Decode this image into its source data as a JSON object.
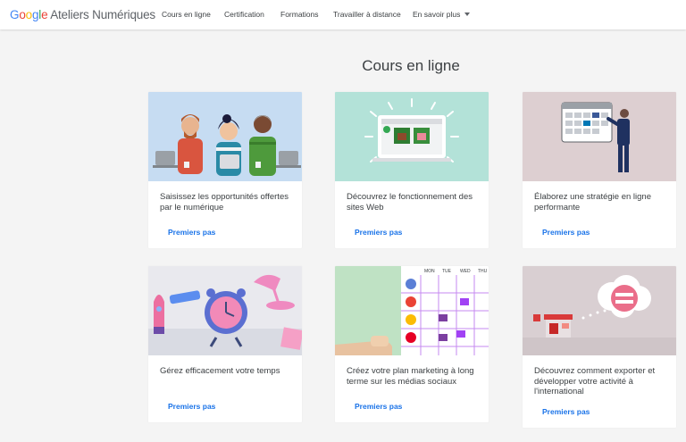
{
  "header": {
    "logo_google": "Google",
    "logo_product": "Ateliers Numériques",
    "nav": [
      {
        "label": "Cours en ligne"
      },
      {
        "label": "Certification"
      },
      {
        "label": "Formations"
      },
      {
        "label": "Travailler à distance"
      },
      {
        "label": "En savoir plus"
      }
    ]
  },
  "main": {
    "title": "Cours en ligne",
    "cards": [
      {
        "title": "Saisissez les opportunités offertes par le numérique",
        "link": "Premiers pas",
        "image_bg": "#c6dcf2"
      },
      {
        "title": "Découvrez le fonctionnement des sites Web",
        "link": "Premiers pas",
        "image_bg": "#b3e2d8"
      },
      {
        "title": "Élaborez une stratégie en ligne performante",
        "link": "Premiers pas",
        "image_bg": "#ddcfd1"
      },
      {
        "title": "Gérez efficacement votre temps",
        "link": "Premiers pas",
        "image_bg": "#e9e9ee"
      },
      {
        "title": "Créez votre plan marketing à long terme sur les médias sociaux",
        "link": "Premiers pas",
        "image_bg": "#bfe2c4"
      },
      {
        "title": "Découvrez comment exporter et développer votre activité à l'international",
        "link": "Premiers pas",
        "image_bg": "#d9cfd2"
      }
    ],
    "calendar_days": [
      "MON",
      "TUE",
      "WED",
      "THU"
    ]
  },
  "colors": {
    "link": "#1a73e8",
    "google_blue": "#4285f4",
    "google_red": "#ea4335",
    "google_yellow": "#fbbc05",
    "google_green": "#34a853"
  }
}
